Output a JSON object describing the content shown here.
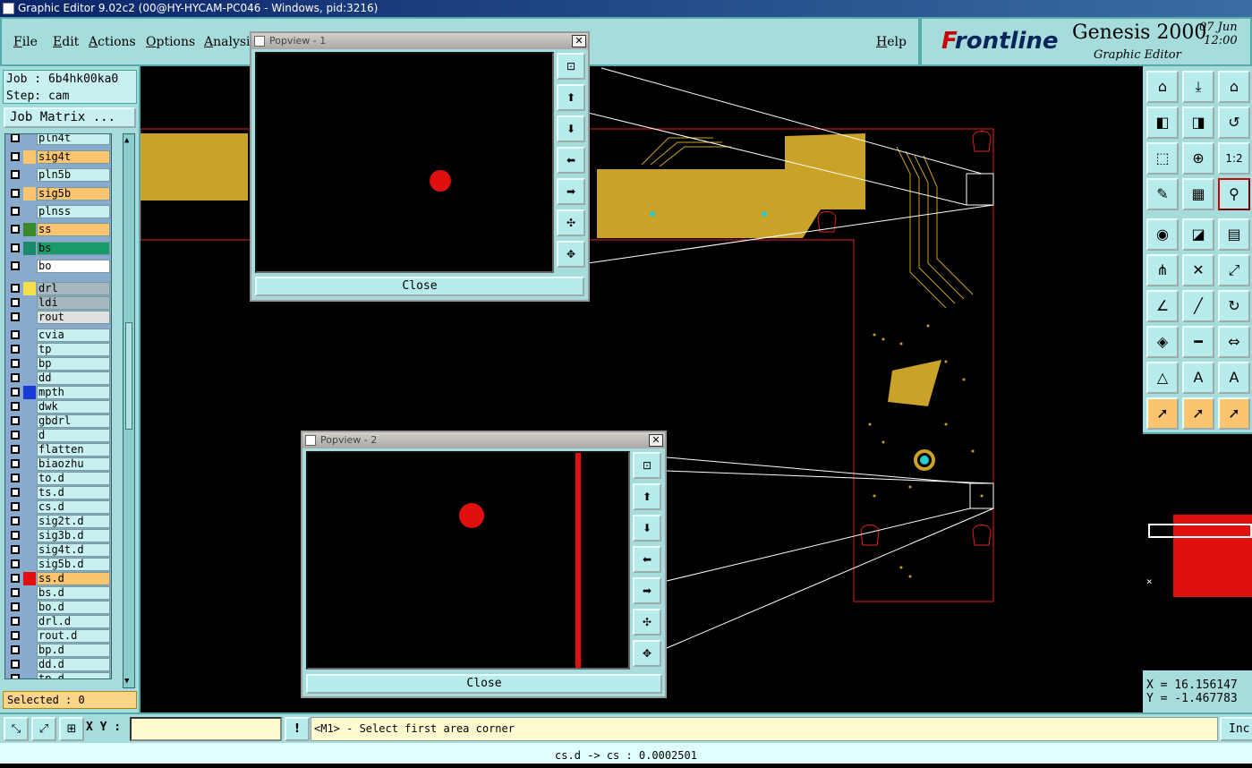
{
  "window": {
    "title": "Graphic Editor 9.02c2 (00@HY-HYCAM-PC046 - Windows, pid:3216)"
  },
  "menu": {
    "file": "File",
    "edit": "Edit",
    "actions": "Actions",
    "options": "Options",
    "analysis": "Analysis",
    "help": "Help"
  },
  "brand": {
    "logo": "Frontline",
    "product": "Genesis 2000",
    "subtitle": "Graphic Editor",
    "date": "07  Jun",
    "time": "12:00"
  },
  "job": {
    "job_line": "Job : 6b4hk00ka0",
    "step_line": "Step: cam",
    "matrix_button": "Job Matrix ..."
  },
  "layers": [
    {
      "name": "pln4t",
      "color": "#8ac"
    },
    {
      "name": "sig4t",
      "color": "#fbc46e",
      "bg": "#fbc46e"
    },
    {
      "name": "pln5b",
      "color": "#8ac"
    },
    {
      "name": "sig5b",
      "color": "#fbc46e",
      "bg": "#fbc46e"
    },
    {
      "name": "plnss",
      "color": "#8ac"
    },
    {
      "name": "ss",
      "color": "#3a8a2a",
      "bg": "#fbc46e"
    },
    {
      "name": "bs",
      "color": "#1a8a6a",
      "bg": "#1a9a6a"
    },
    {
      "name": "bo",
      "color": "#8ac",
      "bg": "#ffffff"
    },
    {
      "name": "drl",
      "color": "#f5e04a",
      "bg": "#a8b8c0"
    },
    {
      "name": "ldi",
      "color": "#8ac",
      "bg": "#a8b8c0"
    },
    {
      "name": "rout",
      "color": "#8ac",
      "bg": "#e0e0e0"
    },
    {
      "name": "cvia",
      "color": "#8ac"
    },
    {
      "name": "tp",
      "color": "#8ac"
    },
    {
      "name": "bp",
      "color": "#8ac"
    },
    {
      "name": "dd",
      "color": "#8ac"
    },
    {
      "name": "mpth",
      "color": "#1a3ad8"
    },
    {
      "name": "dwk",
      "color": "#8ac"
    },
    {
      "name": "gbdrl",
      "color": "#8ac"
    },
    {
      "name": "d",
      "color": "#8ac"
    },
    {
      "name": "flatten",
      "color": "#8ac"
    },
    {
      "name": "biaozhu",
      "color": "#8ac"
    },
    {
      "name": "to.d",
      "color": "#8ac"
    },
    {
      "name": "ts.d",
      "color": "#8ac"
    },
    {
      "name": "cs.d",
      "color": "#8ac"
    },
    {
      "name": "sig2t.d",
      "color": "#8ac"
    },
    {
      "name": "sig3b.d",
      "color": "#8ac"
    },
    {
      "name": "sig4t.d",
      "color": "#8ac"
    },
    {
      "name": "sig5b.d",
      "color": "#8ac"
    },
    {
      "name": "ss.d",
      "color": "#e01010",
      "bg": "#fbc46e"
    },
    {
      "name": "bs.d",
      "color": "#8ac"
    },
    {
      "name": "bo.d",
      "color": "#8ac"
    },
    {
      "name": "drl.d",
      "color": "#8ac"
    },
    {
      "name": "rout.d",
      "color": "#8ac"
    },
    {
      "name": "bp.d",
      "color": "#8ac"
    },
    {
      "name": "dd.d",
      "color": "#8ac"
    },
    {
      "name": "tp.d",
      "color": "#8ac"
    }
  ],
  "selected": "Selected : 0",
  "popview1": {
    "title": "Popview - 1",
    "close": "Close"
  },
  "popview2": {
    "title": "Popview - 2",
    "close": "Close"
  },
  "coords": {
    "x": "X = 16.156147",
    "y": "Y = -1.467783"
  },
  "bottom": {
    "xy_label": "X Y :",
    "xy_value": "",
    "prompt": "<M1> - Select first area corner",
    "inc": "Inc",
    "status": "cs.d -> cs : 0.0002501"
  },
  "toolbar_icons": [
    "zoom-home-icon",
    "zoom-back-icon",
    "home-icon",
    "pan-left-icon",
    "pan-right-icon",
    "undo-icon",
    "zoom-fit-icon",
    "zoom-center-icon",
    "scale-1-2-icon",
    "measure-icon",
    "grid-icon",
    "snap-icon",
    "select-feature-icon",
    "edit-line-icon",
    "ruler-icon",
    "net-icon",
    "cross-icon",
    "route-icon",
    "angle-icon",
    "line-icon",
    "arc-icon",
    "pad-icon",
    "shorten-icon",
    "stretch-icon",
    "triangle-icon",
    "text-a-icon",
    "text-a-red-icon",
    "pointer-icon",
    "pointer-box-icon",
    "pointer-red-icon"
  ],
  "colors": {
    "panel": "#a6dcdc",
    "copper": "#c9a227",
    "outline": "#e02020"
  }
}
